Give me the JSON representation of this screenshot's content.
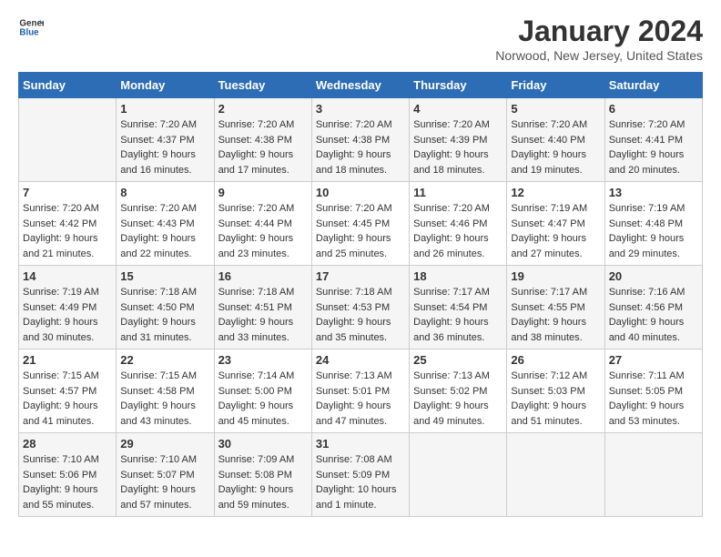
{
  "logo": {
    "line1": "General",
    "line2": "Blue"
  },
  "title": "January 2024",
  "subtitle": "Norwood, New Jersey, United States",
  "weekdays": [
    "Sunday",
    "Monday",
    "Tuesday",
    "Wednesday",
    "Thursday",
    "Friday",
    "Saturday"
  ],
  "weeks": [
    [
      {
        "day": "",
        "info": ""
      },
      {
        "day": "1",
        "info": "Sunrise: 7:20 AM\nSunset: 4:37 PM\nDaylight: 9 hours\nand 16 minutes."
      },
      {
        "day": "2",
        "info": "Sunrise: 7:20 AM\nSunset: 4:38 PM\nDaylight: 9 hours\nand 17 minutes."
      },
      {
        "day": "3",
        "info": "Sunrise: 7:20 AM\nSunset: 4:38 PM\nDaylight: 9 hours\nand 18 minutes."
      },
      {
        "day": "4",
        "info": "Sunrise: 7:20 AM\nSunset: 4:39 PM\nDaylight: 9 hours\nand 18 minutes."
      },
      {
        "day": "5",
        "info": "Sunrise: 7:20 AM\nSunset: 4:40 PM\nDaylight: 9 hours\nand 19 minutes."
      },
      {
        "day": "6",
        "info": "Sunrise: 7:20 AM\nSunset: 4:41 PM\nDaylight: 9 hours\nand 20 minutes."
      }
    ],
    [
      {
        "day": "7",
        "info": "Sunrise: 7:20 AM\nSunset: 4:42 PM\nDaylight: 9 hours\nand 21 minutes."
      },
      {
        "day": "8",
        "info": "Sunrise: 7:20 AM\nSunset: 4:43 PM\nDaylight: 9 hours\nand 22 minutes."
      },
      {
        "day": "9",
        "info": "Sunrise: 7:20 AM\nSunset: 4:44 PM\nDaylight: 9 hours\nand 23 minutes."
      },
      {
        "day": "10",
        "info": "Sunrise: 7:20 AM\nSunset: 4:45 PM\nDaylight: 9 hours\nand 25 minutes."
      },
      {
        "day": "11",
        "info": "Sunrise: 7:20 AM\nSunset: 4:46 PM\nDaylight: 9 hours\nand 26 minutes."
      },
      {
        "day": "12",
        "info": "Sunrise: 7:19 AM\nSunset: 4:47 PM\nDaylight: 9 hours\nand 27 minutes."
      },
      {
        "day": "13",
        "info": "Sunrise: 7:19 AM\nSunset: 4:48 PM\nDaylight: 9 hours\nand 29 minutes."
      }
    ],
    [
      {
        "day": "14",
        "info": "Sunrise: 7:19 AM\nSunset: 4:49 PM\nDaylight: 9 hours\nand 30 minutes."
      },
      {
        "day": "15",
        "info": "Sunrise: 7:18 AM\nSunset: 4:50 PM\nDaylight: 9 hours\nand 31 minutes."
      },
      {
        "day": "16",
        "info": "Sunrise: 7:18 AM\nSunset: 4:51 PM\nDaylight: 9 hours\nand 33 minutes."
      },
      {
        "day": "17",
        "info": "Sunrise: 7:18 AM\nSunset: 4:53 PM\nDaylight: 9 hours\nand 35 minutes."
      },
      {
        "day": "18",
        "info": "Sunrise: 7:17 AM\nSunset: 4:54 PM\nDaylight: 9 hours\nand 36 minutes."
      },
      {
        "day": "19",
        "info": "Sunrise: 7:17 AM\nSunset: 4:55 PM\nDaylight: 9 hours\nand 38 minutes."
      },
      {
        "day": "20",
        "info": "Sunrise: 7:16 AM\nSunset: 4:56 PM\nDaylight: 9 hours\nand 40 minutes."
      }
    ],
    [
      {
        "day": "21",
        "info": "Sunrise: 7:15 AM\nSunset: 4:57 PM\nDaylight: 9 hours\nand 41 minutes."
      },
      {
        "day": "22",
        "info": "Sunrise: 7:15 AM\nSunset: 4:58 PM\nDaylight: 9 hours\nand 43 minutes."
      },
      {
        "day": "23",
        "info": "Sunrise: 7:14 AM\nSunset: 5:00 PM\nDaylight: 9 hours\nand 45 minutes."
      },
      {
        "day": "24",
        "info": "Sunrise: 7:13 AM\nSunset: 5:01 PM\nDaylight: 9 hours\nand 47 minutes."
      },
      {
        "day": "25",
        "info": "Sunrise: 7:13 AM\nSunset: 5:02 PM\nDaylight: 9 hours\nand 49 minutes."
      },
      {
        "day": "26",
        "info": "Sunrise: 7:12 AM\nSunset: 5:03 PM\nDaylight: 9 hours\nand 51 minutes."
      },
      {
        "day": "27",
        "info": "Sunrise: 7:11 AM\nSunset: 5:05 PM\nDaylight: 9 hours\nand 53 minutes."
      }
    ],
    [
      {
        "day": "28",
        "info": "Sunrise: 7:10 AM\nSunset: 5:06 PM\nDaylight: 9 hours\nand 55 minutes."
      },
      {
        "day": "29",
        "info": "Sunrise: 7:10 AM\nSunset: 5:07 PM\nDaylight: 9 hours\nand 57 minutes."
      },
      {
        "day": "30",
        "info": "Sunrise: 7:09 AM\nSunset: 5:08 PM\nDaylight: 9 hours\nand 59 minutes."
      },
      {
        "day": "31",
        "info": "Sunrise: 7:08 AM\nSunset: 5:09 PM\nDaylight: 10 hours\nand 1 minute."
      },
      {
        "day": "",
        "info": ""
      },
      {
        "day": "",
        "info": ""
      },
      {
        "day": "",
        "info": ""
      }
    ]
  ]
}
